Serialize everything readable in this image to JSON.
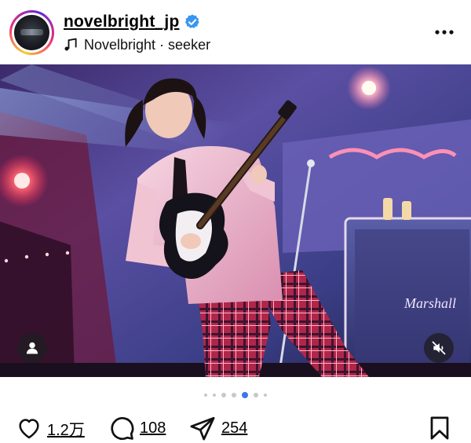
{
  "header": {
    "username": "novelbright_jp",
    "audio": "Novelbright · seeker"
  },
  "photo": {
    "amp_logo": "Marshall"
  },
  "carousel": {
    "dot_count": 7,
    "active_index": 4
  },
  "actions": {
    "likes": "1.2万",
    "comments": "108",
    "shares": "254"
  },
  "colors": {
    "verified": "#3897f0",
    "active_dot": "#3e78e8"
  },
  "icons": [
    "verified-icon",
    "music-note-icon",
    "more-icon",
    "person-tag-icon",
    "mute-icon",
    "heart-icon",
    "comment-icon",
    "share-icon",
    "bookmark-icon"
  ]
}
